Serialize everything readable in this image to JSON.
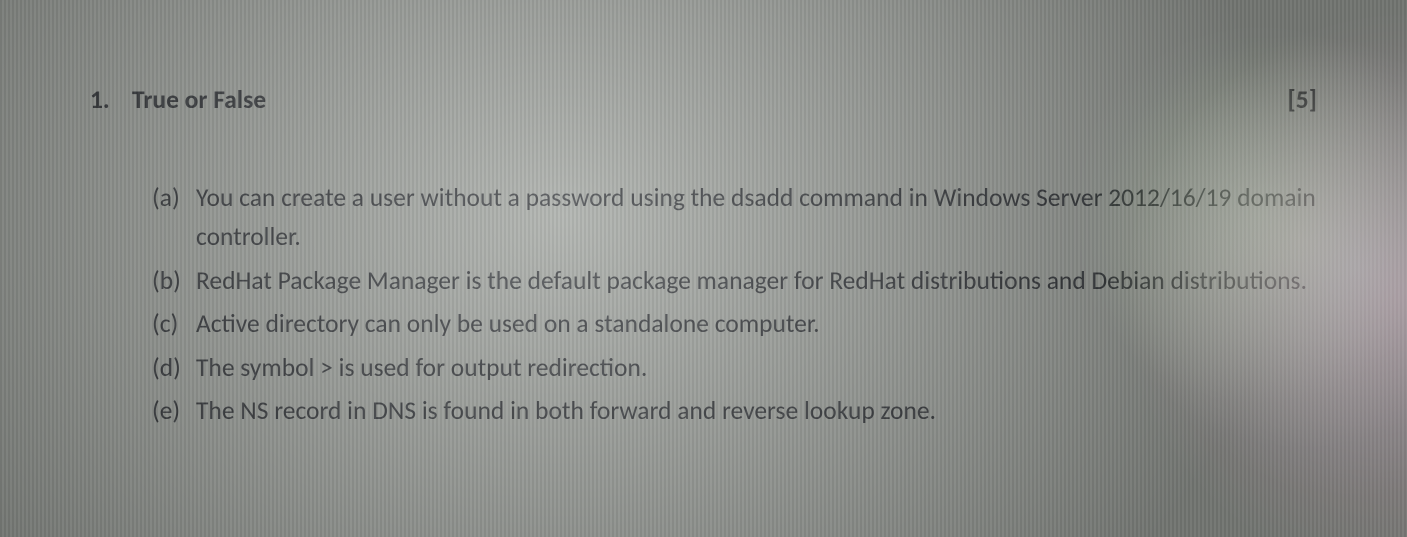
{
  "question": {
    "number": "1.",
    "title": "True or False",
    "marks": "[5]",
    "items": [
      {
        "label": "(a)",
        "text": "You can create a user without a password using the dsadd command in Windows Server 2012/16/19 domain controller."
      },
      {
        "label": "(b)",
        "text": "RedHat Package Manager is the default package manager for RedHat distributions and Debian distributions."
      },
      {
        "label": "(c)",
        "text": "Active directory can only be used on a standalone computer."
      },
      {
        "label": "(d)",
        "text": "The symbol > is used for output redirection."
      },
      {
        "label": "(e)",
        "text": "The NS record in DNS is found in both forward and reverse lookup zone."
      }
    ]
  }
}
